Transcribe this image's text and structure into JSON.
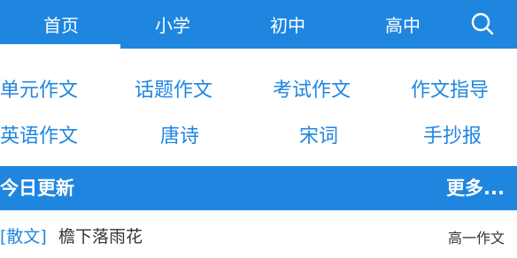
{
  "topbar": {
    "tabs": [
      {
        "label": "首页"
      },
      {
        "label": "小学"
      },
      {
        "label": "初中"
      },
      {
        "label": "高中"
      }
    ]
  },
  "categories": [
    {
      "label": "单元作文"
    },
    {
      "label": "话题作文"
    },
    {
      "label": "考试作文"
    },
    {
      "label": "作文指导"
    },
    {
      "label": "英语作文"
    },
    {
      "label": "唐诗"
    },
    {
      "label": "宋词"
    },
    {
      "label": "手抄报"
    }
  ],
  "updates": {
    "title": "今日更新",
    "more_label": "更多..."
  },
  "articles": [
    {
      "tag": "[散文]",
      "title": "檐下落雨花",
      "grade": "高一作文"
    }
  ],
  "colors": {
    "accent": "#1f86e0",
    "text": "#333333",
    "background": "#ffffff"
  },
  "icons": {
    "search": "search-icon"
  }
}
